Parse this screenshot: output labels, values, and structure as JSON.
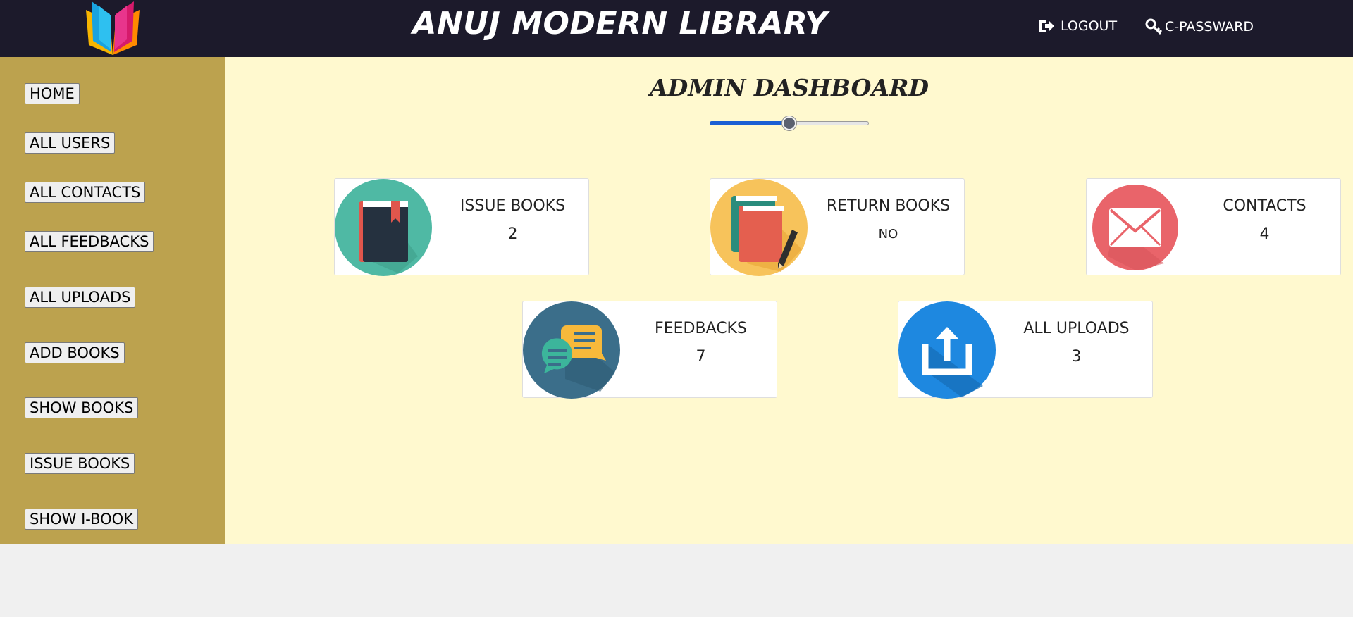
{
  "header": {
    "title": "ANUJ MODERN LIBRARY",
    "logout_label": "LOGOUT",
    "change_password_label": "C-PASSWARD",
    "logo_icon": "open-book-logo-icon",
    "logout_icon": "logout-icon",
    "change_password_icon": "key-icon",
    "colors": {
      "background": "#1c1a2b",
      "text": "#ffffff"
    }
  },
  "sidebar": {
    "background": "#bca24e",
    "items": [
      {
        "label": "HOME"
      },
      {
        "label": "ALL USERS"
      },
      {
        "label": "ALL CONTACTS"
      },
      {
        "label": "ALL FEEDBACKS"
      },
      {
        "label": "ALL UPLOADS"
      },
      {
        "label": "ADD BOOKS"
      },
      {
        "label": "SHOW BOOKS"
      },
      {
        "label": "ISSUE BOOKS"
      },
      {
        "label": "SHOW I-BOOK"
      }
    ]
  },
  "main": {
    "background": "#fff9cf",
    "title": "ADMIN DASHBOARD",
    "slider": {
      "value_fraction": 0.5,
      "accent": "#1a5fd4"
    },
    "cards": [
      {
        "label": "ISSUE BOOKS",
        "count": "2",
        "icon": "book-icon",
        "icon_color": "#4fb9a4"
      },
      {
        "label": "RETURN BOOKS",
        "count": "NO",
        "icon": "books-pencil-icon",
        "icon_color": "#f7c35b"
      },
      {
        "label": "CONTACTS",
        "count": "4",
        "icon": "envelope-icon",
        "icon_color": "#e9646a"
      },
      {
        "label": "FEEDBACKS",
        "count": "7",
        "icon": "chat-bubbles-icon",
        "icon_color": "#3b6e8a"
      },
      {
        "label": "ALL UPLOADS",
        "count": "3",
        "icon": "upload-icon",
        "icon_color": "#1e88e0"
      }
    ]
  }
}
